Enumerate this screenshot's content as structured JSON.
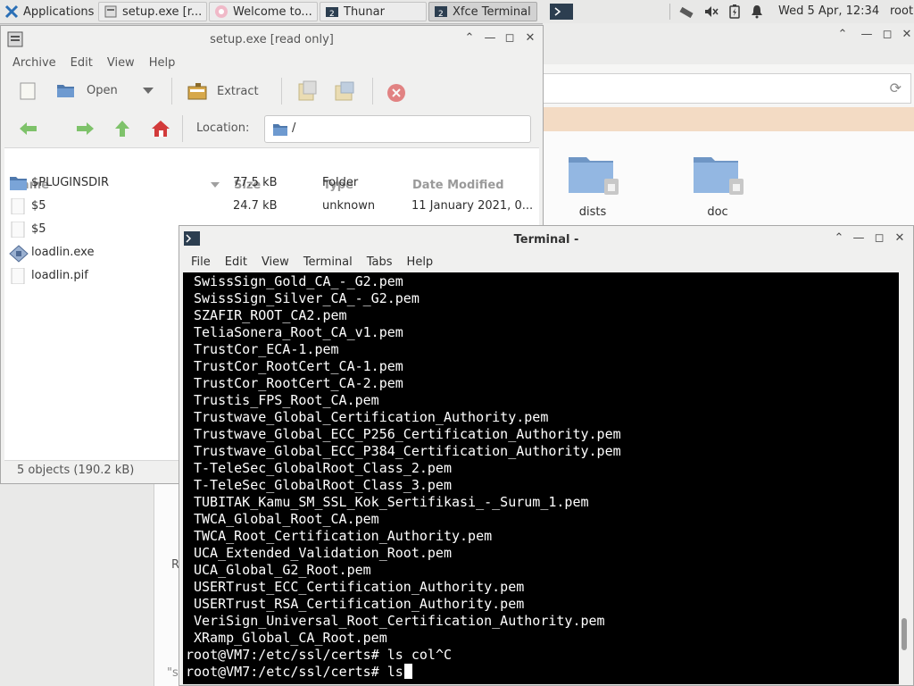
{
  "panel": {
    "tasks": [
      {
        "label": "Applications"
      },
      {
        "label": "setup.exe [r..."
      },
      {
        "label": "Welcome to..."
      },
      {
        "label": "Thunar",
        "badge": "2"
      },
      {
        "label": "Xfce Terminal",
        "badge": "2"
      }
    ],
    "clock": "Wed  5 Apr, 12:34",
    "user": "root"
  },
  "archive": {
    "title": "setup.exe [read only]",
    "menu": [
      "Archive",
      "Edit",
      "View",
      "Help"
    ],
    "toolbar": {
      "open": "Open",
      "extract": "Extract"
    },
    "location_label": "Location:",
    "location_value": "/",
    "columns": [
      "Name",
      "Size",
      "Type",
      "Date Modified"
    ],
    "files": [
      {
        "name": "$PLUGINSDIR",
        "size": "77.5 kB",
        "type": "Folder",
        "date": "",
        "icon": "folder-icon"
      },
      {
        "name": "$5",
        "size": "24.7 kB",
        "type": "unknown",
        "date": "11 January 2021, 0...",
        "icon": "document-icon"
      },
      {
        "name": "$5",
        "size": "",
        "type": "",
        "date": "",
        "icon": "document-icon"
      },
      {
        "name": "loadlin.exe",
        "size": "",
        "type": "",
        "date": "",
        "icon": "executable-icon"
      },
      {
        "name": "loadlin.pif",
        "size": "",
        "type": "",
        "date": "",
        "icon": "document-icon"
      }
    ],
    "status": "5 objects (190.2 kB)"
  },
  "thunar": {
    "folders": [
      {
        "name": "dists"
      },
      {
        "name": "doc"
      }
    ],
    "partial_left": "R",
    "partial_bottom": "\"s"
  },
  "terminal": {
    "title": "Terminal -",
    "menu": [
      "File",
      "Edit",
      "View",
      "Terminal",
      "Tabs",
      "Help"
    ],
    "lines": [
      "SwissSign_Gold_CA_-_G2.pem",
      "SwissSign_Silver_CA_-_G2.pem",
      "SZAFIR_ROOT_CA2.pem",
      "TeliaSonera_Root_CA_v1.pem",
      "TrustCor_ECA-1.pem",
      "TrustCor_RootCert_CA-1.pem",
      "TrustCor_RootCert_CA-2.pem",
      "Trustis_FPS_Root_CA.pem",
      "Trustwave_Global_Certification_Authority.pem",
      "Trustwave_Global_ECC_P256_Certification_Authority.pem",
      "Trustwave_Global_ECC_P384_Certification_Authority.pem",
      "T-TeleSec_GlobalRoot_Class_2.pem",
      "T-TeleSec_GlobalRoot_Class_3.pem",
      "TUBITAK_Kamu_SM_SSL_Kok_Sertifikasi_-_Surum_1.pem",
      "TWCA_Global_Root_CA.pem",
      "TWCA_Root_Certification_Authority.pem",
      "UCA_Extended_Validation_Root.pem",
      "UCA_Global_G2_Root.pem",
      "USERTrust_ECC_Certification_Authority.pem",
      "USERTrust_RSA_Certification_Authority.pem",
      "VeriSign_Universal_Root_Certification_Authority.pem",
      "XRamp_Global_CA_Root.pem"
    ],
    "prompts": [
      "root@VM7:/etc/ssl/certs# ls col^C",
      "root@VM7:/etc/ssl/certs# ls"
    ],
    "scroll_fraction": 0.92
  }
}
